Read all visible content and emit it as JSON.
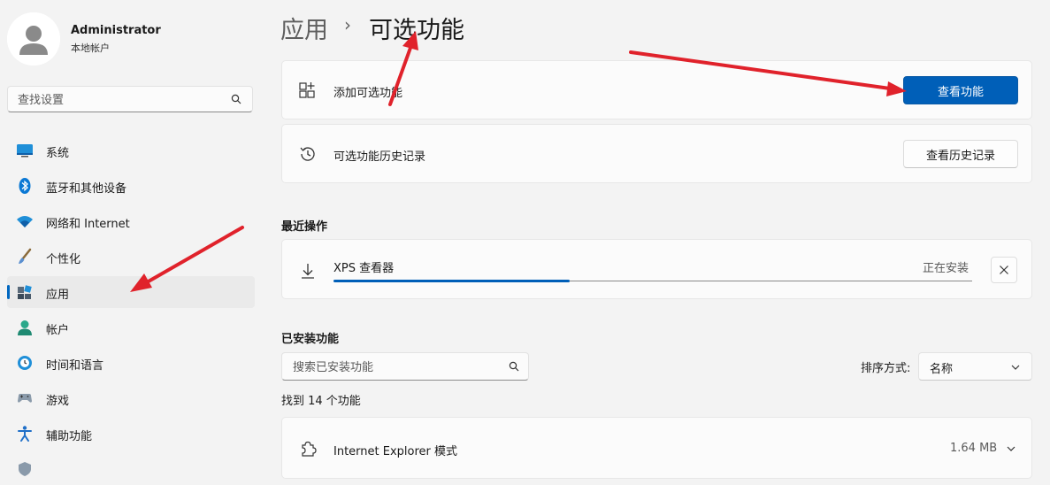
{
  "user": {
    "name": "Administrator",
    "account_type": "本地帐户"
  },
  "sidebar": {
    "search_placeholder": "查找设置",
    "items": [
      {
        "label": "系统",
        "icon": "monitor-icon"
      },
      {
        "label": "蓝牙和其他设备",
        "icon": "bluetooth-icon"
      },
      {
        "label": "网络和 Internet",
        "icon": "wifi-icon"
      },
      {
        "label": "个性化",
        "icon": "brush-icon"
      },
      {
        "label": "应用",
        "icon": "apps-icon",
        "selected": true
      },
      {
        "label": "帐户",
        "icon": "account-icon"
      },
      {
        "label": "时间和语言",
        "icon": "clock-globe-icon"
      },
      {
        "label": "游戏",
        "icon": "gamepad-icon"
      },
      {
        "label": "辅助功能",
        "icon": "accessibility-icon"
      }
    ]
  },
  "breadcrumb": {
    "parent": "应用",
    "separator": "›",
    "current": "可选功能"
  },
  "add_card": {
    "label": "添加可选功能",
    "button": "查看功能"
  },
  "history_card": {
    "label": "可选功能历史记录",
    "button": "查看历史记录"
  },
  "recent": {
    "title": "最近操作",
    "item": {
      "name": "XPS 查看器",
      "status": "正在安装",
      "progress": 0.37
    }
  },
  "installed": {
    "title": "已安装功能",
    "search_placeholder": "搜索已安装功能",
    "sort_label": "排序方式:",
    "sort_value": "名称",
    "count_text": "找到 14 个功能",
    "features": [
      {
        "name": "Internet Explorer 模式",
        "size": "1.64 MB"
      }
    ]
  },
  "colors": {
    "accent": "#005fb8",
    "annotation_arrow": "#e0222b"
  }
}
